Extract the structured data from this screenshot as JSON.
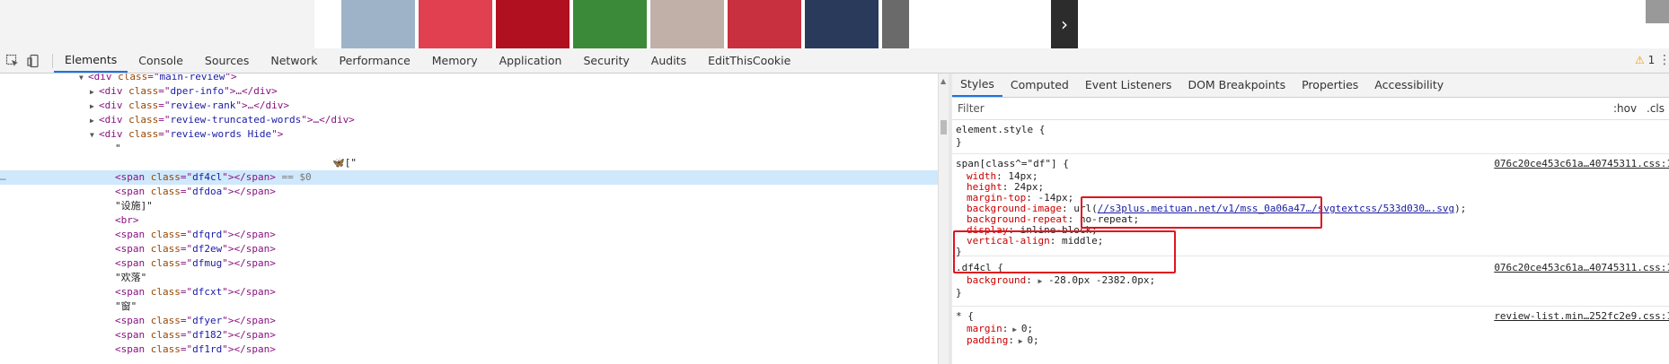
{
  "thumbnails": [
    {
      "icon": "photo-woman-city",
      "color": "#9fb3c8"
    },
    {
      "icon": "photo-phone-red",
      "color": "#e04050"
    },
    {
      "icon": "photo-red-light",
      "color": "#b01020"
    },
    {
      "icon": "photo-salad",
      "color": "#3a8a3a"
    },
    {
      "icon": "photo-woman-sitting",
      "color": "#c0b0a8"
    },
    {
      "icon": "photo-red-umbrellas",
      "color": "#c83040"
    },
    {
      "icon": "photo-city-night",
      "color": "#2a3a5a"
    },
    {
      "icon": "photo-partial",
      "color": "#6a6a6a"
    }
  ],
  "devtools": {
    "tabs": [
      "Elements",
      "Console",
      "Sources",
      "Network",
      "Performance",
      "Memory",
      "Application",
      "Security",
      "Audits",
      "EditThisCookie"
    ],
    "active_tab": "Elements",
    "warning_count": "1"
  },
  "dom": [
    {
      "indent": 0,
      "arrow": "▼",
      "tag": "div",
      "class": "main-review",
      "tail": ">"
    },
    {
      "indent": 1,
      "arrow": "▶",
      "tag": "div",
      "class": "dper-info",
      "tail": ">…</div>"
    },
    {
      "indent": 1,
      "arrow": "▶",
      "tag": "div",
      "class": "review-rank",
      "tail": ">…</div>"
    },
    {
      "indent": 1,
      "arrow": "▶",
      "tag": "div",
      "class": "review-truncated-words",
      "tail": ">…</div>"
    },
    {
      "indent": 1,
      "arrow": "▼",
      "tag": "div",
      "class": "review-words Hide",
      "tail": ">"
    },
    {
      "indent": 2,
      "text": "\""
    },
    {
      "indent": 2,
      "text": "🦋[\"",
      "offset": 370
    },
    {
      "indent": 2,
      "tag": "span",
      "class": "df4cl",
      "tail": "></span>",
      "suffix": " == $0",
      "selected": true
    },
    {
      "indent": 2,
      "tag": "span",
      "class": "dfdoa",
      "tail": "></span>"
    },
    {
      "indent": 2,
      "text": "\"设施]\""
    },
    {
      "indent": 2,
      "raw": "<br>"
    },
    {
      "indent": 2,
      "tag": "span",
      "class": "dfqrd",
      "tail": "></span>"
    },
    {
      "indent": 2,
      "tag": "span",
      "class": "df2ew",
      "tail": "></span>"
    },
    {
      "indent": 2,
      "tag": "span",
      "class": "dfmug",
      "tail": "></span>"
    },
    {
      "indent": 2,
      "text": "\"欢落\""
    },
    {
      "indent": 2,
      "tag": "span",
      "class": "dfcxt",
      "tail": "></span>"
    },
    {
      "indent": 2,
      "text": "\"窗\""
    },
    {
      "indent": 2,
      "tag": "span",
      "class": "dfyer",
      "tail": "></span>"
    },
    {
      "indent": 2,
      "tag": "span",
      "class": "df182",
      "tail": "></span>"
    },
    {
      "indent": 2,
      "tag": "span",
      "class": "df1rd",
      "tail": "></span>"
    }
  ],
  "styles": {
    "subtabs": [
      "Styles",
      "Computed",
      "Event Listeners",
      "DOM Breakpoints",
      "Properties",
      "Accessibility"
    ],
    "active_subtab": "Styles",
    "filter_placeholder": "Filter",
    "hov": ":hov",
    "cls": ".cls",
    "element_style": "element.style {",
    "close_brace": "}",
    "rule1": {
      "selector": "span[class^=\"df\"] {",
      "source": "076c20ce453c61a…40745311.css:1",
      "props": [
        {
          "name": "width",
          "value": "14px;"
        },
        {
          "name": "height",
          "value": "24px;"
        },
        {
          "name": "margin-top",
          "value": "-14px;"
        },
        {
          "name": "background-image",
          "value_pre": "url(",
          "link": "//s3plus.meituan.net/v1/mss_0a06a47…/svgtextcss/533d030….svg",
          "value_post": ");"
        },
        {
          "name": "background-repeat",
          "value": "no-repeat;"
        },
        {
          "name": "display",
          "value": "inline-block;"
        },
        {
          "name": "vertical-align",
          "value": "middle;"
        }
      ]
    },
    "rule2": {
      "selector": ".df4cl {",
      "source": "076c20ce453c61a…40745311.css:1",
      "prop_name": "background",
      "prop_value": "-28.0px -2382.0px;"
    },
    "rule3": {
      "selector": "* {",
      "source": "review-list.min…252fc2e9.css:1",
      "props": [
        {
          "name": "margin",
          "value": "0;"
        },
        {
          "name": "padding",
          "value": "0;"
        }
      ]
    }
  }
}
